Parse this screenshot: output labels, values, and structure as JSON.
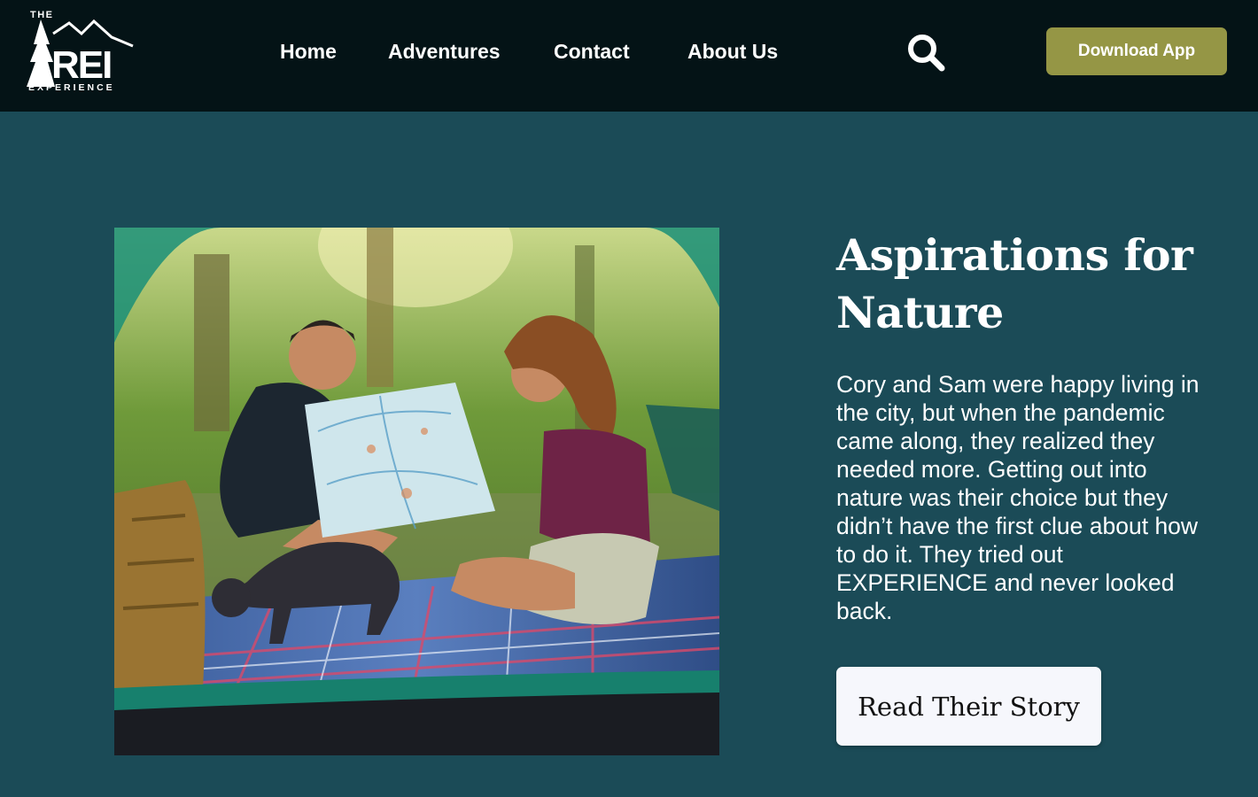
{
  "header": {
    "logo": {
      "top_text": "THE",
      "brand_text": "REI",
      "bottom_text": "EXPERIENCE",
      "icon": "rei-logo-mountain-tree"
    },
    "nav": [
      {
        "label": "Home"
      },
      {
        "label": "Adventures"
      },
      {
        "label": "Contact"
      },
      {
        "label": "About Us"
      }
    ],
    "search_icon": "search-icon",
    "download_button": "Download App"
  },
  "hero": {
    "image_alt": "Couple sitting on a plaid blanket inside a tent looking at a map with a small dog",
    "headline": "Aspirations for Nature",
    "body": "Cory and Sam were happy living in the city, but when the pandemic came along, they realized they needed more. Getting out into nature was their choice but they didn’t have the first clue about how to do it. They tried out EXPERIENCE and never looked back.",
    "cta": "Read Their Story"
  },
  "colors": {
    "header_bg": "#041316",
    "page_bg": "#1b4b57",
    "accent_olive": "#959645",
    "button_light": "#f6f7fc"
  }
}
